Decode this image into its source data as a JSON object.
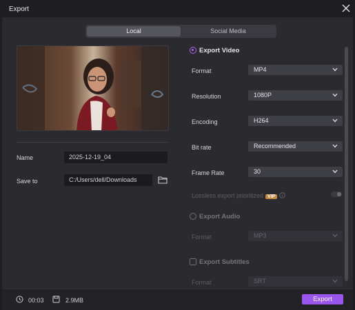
{
  "window": {
    "title": "Export"
  },
  "tabs": [
    {
      "label": "Local",
      "active": true
    },
    {
      "label": "Social Media",
      "active": false
    }
  ],
  "left": {
    "name_label": "Name",
    "name_value": "2025-12-19_04",
    "save_label": "Save to",
    "save_value": "C:/Users/dell/Downloads"
  },
  "video": {
    "title": "Export Video",
    "selected": true,
    "rows": [
      {
        "label": "Format",
        "value": "MP4"
      },
      {
        "label": "Resolution",
        "value": "1080P"
      },
      {
        "label": "Encoding",
        "value": "H264"
      },
      {
        "label": "Bit rate",
        "value": "Recommended"
      },
      {
        "label": "Frame Rate",
        "value": "30"
      }
    ],
    "lossless_label": "Lossless export prioritized",
    "vip_badge": "VIP",
    "lossless_enabled": false
  },
  "audio": {
    "title": "Export Audio",
    "selected": false,
    "format_label": "Format",
    "format_value": "MP3"
  },
  "subtitles": {
    "title": "Export Subtitles",
    "checked": false,
    "format_label": "Format",
    "format_value": "SRT"
  },
  "footer": {
    "duration": "00:03",
    "size": "2.9MB",
    "export_label": "Export"
  },
  "colors": {
    "accent": "#9a55ee",
    "background": "#2a2a2f",
    "field": "#3e3e45"
  }
}
